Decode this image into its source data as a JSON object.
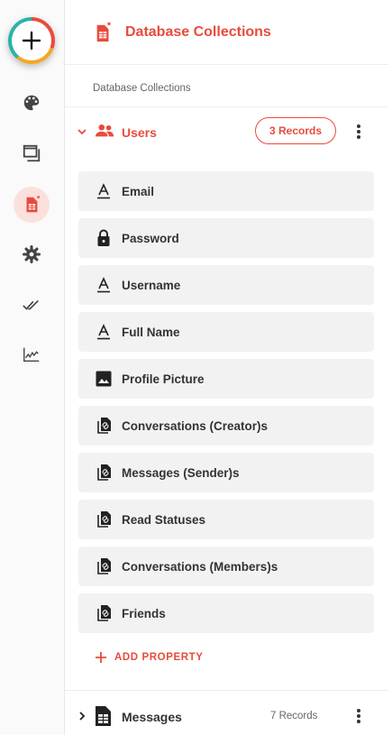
{
  "colors": {
    "accent": "#e84b3c",
    "rail_active_bg": "#fce0dd",
    "property_bg": "#f2f2f2"
  },
  "rail": {
    "items": [
      {
        "name": "add",
        "icon": "plus-icon"
      },
      {
        "name": "theme",
        "icon": "palette-icon"
      },
      {
        "name": "screens",
        "icon": "windows-icon"
      },
      {
        "name": "database",
        "icon": "database-icon",
        "active": true
      },
      {
        "name": "settings",
        "icon": "gear-icon"
      },
      {
        "name": "actions",
        "icon": "double-check-icon"
      },
      {
        "name": "analytics",
        "icon": "chart-icon"
      }
    ]
  },
  "header": {
    "title": "Database Collections",
    "icon": "database-icon"
  },
  "breadcrumb": "Database Collections",
  "collections": [
    {
      "name": "Users",
      "records": "3 Records",
      "expanded": true,
      "icon": "people-icon",
      "properties": [
        {
          "label": "Email",
          "icon": "text-icon"
        },
        {
          "label": "Password",
          "icon": "lock-icon"
        },
        {
          "label": "Username",
          "icon": "text-icon"
        },
        {
          "label": "Full Name",
          "icon": "text-icon"
        },
        {
          "label": "Profile Picture",
          "icon": "image-icon"
        },
        {
          "label": "Conversations (Creator)s",
          "icon": "relation-icon"
        },
        {
          "label": "Messages (Sender)s",
          "icon": "relation-icon"
        },
        {
          "label": "Read Statuses",
          "icon": "relation-icon"
        },
        {
          "label": "Conversations (Members)s",
          "icon": "relation-icon"
        },
        {
          "label": "Friends",
          "icon": "relation-icon"
        }
      ],
      "add_property_label": "ADD PROPERTY"
    },
    {
      "name": "Messages",
      "records": "7 Records",
      "expanded": false,
      "icon": "table-icon"
    }
  ]
}
